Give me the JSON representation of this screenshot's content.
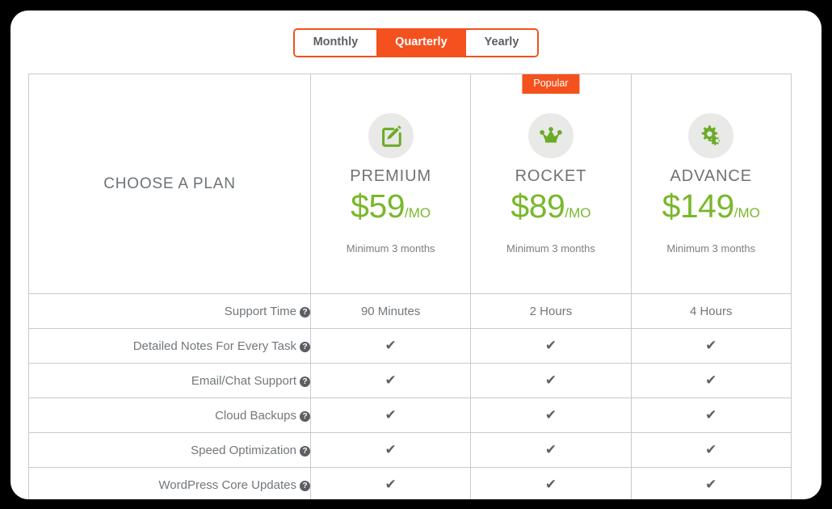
{
  "theme": {
    "accent_orange": "#F4511E",
    "price_green": "#79b82c",
    "text_gray": "#72777b",
    "border_gray": "#cacaca",
    "icon_bg": "#e9e9e7",
    "page_bg": "#000000",
    "card_bg": "#ffffff"
  },
  "billing_toggle": {
    "options": [
      {
        "label": "Monthly",
        "active": false
      },
      {
        "label": "Quarterly",
        "active": true
      },
      {
        "label": "Yearly",
        "active": false
      }
    ]
  },
  "table": {
    "feature_column_title": "CHOOSE A PLAN",
    "plans": [
      {
        "name": "PREMIUM",
        "icon": "pencil-note-icon",
        "currency": "$",
        "amount": "59",
        "period": "/MO",
        "note": "Minimum 3 months",
        "badge": null
      },
      {
        "name": "ROCKET",
        "icon": "crown-icon",
        "currency": "$",
        "amount": "89",
        "period": "/MO",
        "note": "Minimum 3 months",
        "badge": "Popular"
      },
      {
        "name": "ADVANCE",
        "icon": "gears-icon",
        "currency": "$",
        "amount": "149",
        "period": "/MO",
        "note": "Minimum 3 months",
        "badge": null
      }
    ],
    "help_glyph": "?",
    "check_glyph": "✔",
    "features": [
      {
        "label": "Support Time",
        "has_help": true,
        "values": [
          "90 Minutes",
          "2 Hours",
          "4 Hours"
        ],
        "value_type": "text"
      },
      {
        "label": "Detailed Notes For Every Task",
        "has_help": true,
        "values": [
          "✔",
          "✔",
          "✔"
        ],
        "value_type": "check"
      },
      {
        "label": "Email/Chat Support",
        "has_help": true,
        "values": [
          "✔",
          "✔",
          "✔"
        ],
        "value_type": "check"
      },
      {
        "label": "Cloud Backups",
        "has_help": true,
        "values": [
          "✔",
          "✔",
          "✔"
        ],
        "value_type": "check"
      },
      {
        "label": "Speed Optimization",
        "has_help": true,
        "values": [
          "✔",
          "✔",
          "✔"
        ],
        "value_type": "check"
      },
      {
        "label": "WordPress Core Updates",
        "has_help": true,
        "values": [
          "✔",
          "✔",
          "✔"
        ],
        "value_type": "check"
      }
    ]
  }
}
